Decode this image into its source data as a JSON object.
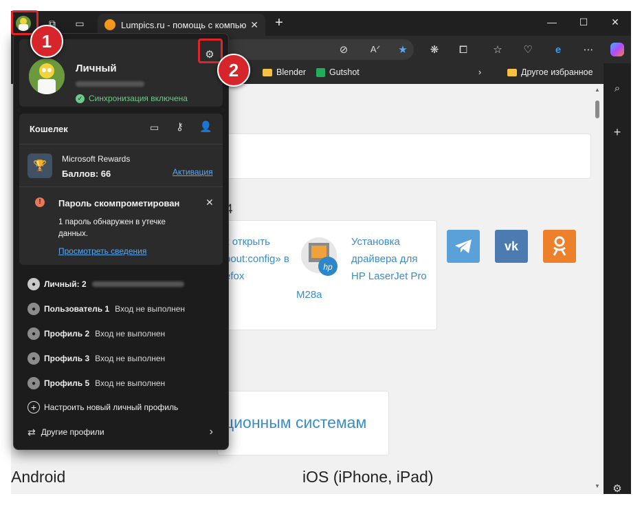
{
  "browser": {
    "tab_title": "Lumpics.ru - помощь с компьюте",
    "bookmarks": [
      "Blender",
      "Gutshot",
      "Другое избранное"
    ]
  },
  "profile_panel": {
    "name": "Личный",
    "sync_status": "Синхронизация включена",
    "wallet_title": "Кошелек",
    "rewards_title": "Microsoft Rewards",
    "rewards_points": "Баллов: 66",
    "rewards_link": "Активация",
    "alert_title": "Пароль скомпрометирован",
    "alert_text": "1 пароль обнаружен в утечке данных.",
    "alert_link": "Просмотреть сведения",
    "profiles": [
      {
        "name": "Личный: 2",
        "status": ""
      },
      {
        "name": "Пользователь 1",
        "status": "Вход не выполнен"
      },
      {
        "name": "Профиль 2",
        "status": "Вход не выполнен"
      },
      {
        "name": "Профиль 3",
        "status": "Вход не выполнен"
      },
      {
        "name": "Профиль 5",
        "status": "Вход не выполнен"
      }
    ],
    "new_profile": "Настроить новый личный профиль",
    "other_profiles": "Другие профили"
  },
  "page": {
    "fragment_number": "4",
    "article1": [
      "к открыть",
      "bout:config» в",
      "efox"
    ],
    "article2": [
      "Установка",
      "драйвера для",
      "HP LaserJet Pro"
    ],
    "article2_tail": "M28a",
    "section_heading": "ционным системам",
    "os_left": "Android",
    "os_right": "iOS (iPhone, iPad)",
    "social": [
      "telegram",
      "vk",
      "odnoklassniki"
    ]
  },
  "annotations": {
    "step1": "1",
    "step2": "2"
  },
  "colors": {
    "accent_red": "#e0242a",
    "link": "#3a8cc8",
    "telegram": "#5ba1d9",
    "vk": "#4b7bb1",
    "ok": "#ed812b"
  }
}
